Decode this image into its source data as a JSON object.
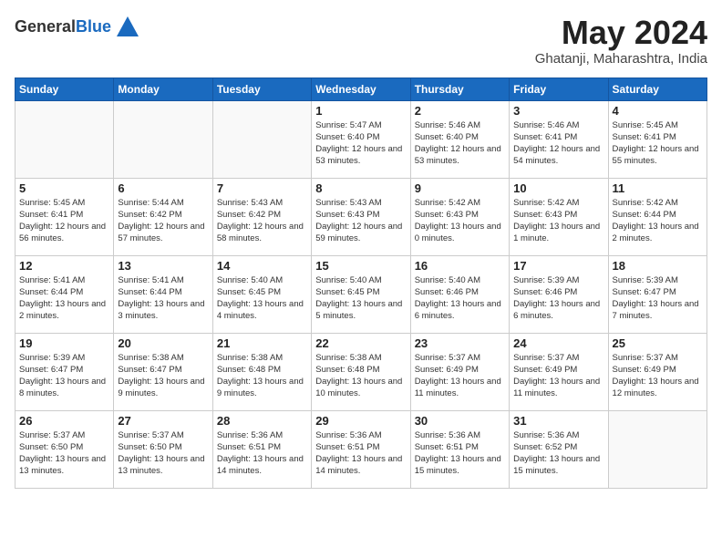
{
  "logo": {
    "general": "General",
    "blue": "Blue"
  },
  "title": "May 2024",
  "location": "Ghatanji, Maharashtra, India",
  "days_of_week": [
    "Sunday",
    "Monday",
    "Tuesday",
    "Wednesday",
    "Thursday",
    "Friday",
    "Saturday"
  ],
  "weeks": [
    [
      {
        "day": "",
        "info": ""
      },
      {
        "day": "",
        "info": ""
      },
      {
        "day": "",
        "info": ""
      },
      {
        "day": "1",
        "info": "Sunrise: 5:47 AM\nSunset: 6:40 PM\nDaylight: 12 hours\nand 53 minutes."
      },
      {
        "day": "2",
        "info": "Sunrise: 5:46 AM\nSunset: 6:40 PM\nDaylight: 12 hours\nand 53 minutes."
      },
      {
        "day": "3",
        "info": "Sunrise: 5:46 AM\nSunset: 6:41 PM\nDaylight: 12 hours\nand 54 minutes."
      },
      {
        "day": "4",
        "info": "Sunrise: 5:45 AM\nSunset: 6:41 PM\nDaylight: 12 hours\nand 55 minutes."
      }
    ],
    [
      {
        "day": "5",
        "info": "Sunrise: 5:45 AM\nSunset: 6:41 PM\nDaylight: 12 hours\nand 56 minutes."
      },
      {
        "day": "6",
        "info": "Sunrise: 5:44 AM\nSunset: 6:42 PM\nDaylight: 12 hours\nand 57 minutes."
      },
      {
        "day": "7",
        "info": "Sunrise: 5:43 AM\nSunset: 6:42 PM\nDaylight: 12 hours\nand 58 minutes."
      },
      {
        "day": "8",
        "info": "Sunrise: 5:43 AM\nSunset: 6:43 PM\nDaylight: 12 hours\nand 59 minutes."
      },
      {
        "day": "9",
        "info": "Sunrise: 5:42 AM\nSunset: 6:43 PM\nDaylight: 13 hours\nand 0 minutes."
      },
      {
        "day": "10",
        "info": "Sunrise: 5:42 AM\nSunset: 6:43 PM\nDaylight: 13 hours\nand 1 minute."
      },
      {
        "day": "11",
        "info": "Sunrise: 5:42 AM\nSunset: 6:44 PM\nDaylight: 13 hours\nand 2 minutes."
      }
    ],
    [
      {
        "day": "12",
        "info": "Sunrise: 5:41 AM\nSunset: 6:44 PM\nDaylight: 13 hours\nand 2 minutes."
      },
      {
        "day": "13",
        "info": "Sunrise: 5:41 AM\nSunset: 6:44 PM\nDaylight: 13 hours\nand 3 minutes."
      },
      {
        "day": "14",
        "info": "Sunrise: 5:40 AM\nSunset: 6:45 PM\nDaylight: 13 hours\nand 4 minutes."
      },
      {
        "day": "15",
        "info": "Sunrise: 5:40 AM\nSunset: 6:45 PM\nDaylight: 13 hours\nand 5 minutes."
      },
      {
        "day": "16",
        "info": "Sunrise: 5:40 AM\nSunset: 6:46 PM\nDaylight: 13 hours\nand 6 minutes."
      },
      {
        "day": "17",
        "info": "Sunrise: 5:39 AM\nSunset: 6:46 PM\nDaylight: 13 hours\nand 6 minutes."
      },
      {
        "day": "18",
        "info": "Sunrise: 5:39 AM\nSunset: 6:47 PM\nDaylight: 13 hours\nand 7 minutes."
      }
    ],
    [
      {
        "day": "19",
        "info": "Sunrise: 5:39 AM\nSunset: 6:47 PM\nDaylight: 13 hours\nand 8 minutes."
      },
      {
        "day": "20",
        "info": "Sunrise: 5:38 AM\nSunset: 6:47 PM\nDaylight: 13 hours\nand 9 minutes."
      },
      {
        "day": "21",
        "info": "Sunrise: 5:38 AM\nSunset: 6:48 PM\nDaylight: 13 hours\nand 9 minutes."
      },
      {
        "day": "22",
        "info": "Sunrise: 5:38 AM\nSunset: 6:48 PM\nDaylight: 13 hours\nand 10 minutes."
      },
      {
        "day": "23",
        "info": "Sunrise: 5:37 AM\nSunset: 6:49 PM\nDaylight: 13 hours\nand 11 minutes."
      },
      {
        "day": "24",
        "info": "Sunrise: 5:37 AM\nSunset: 6:49 PM\nDaylight: 13 hours\nand 11 minutes."
      },
      {
        "day": "25",
        "info": "Sunrise: 5:37 AM\nSunset: 6:49 PM\nDaylight: 13 hours\nand 12 minutes."
      }
    ],
    [
      {
        "day": "26",
        "info": "Sunrise: 5:37 AM\nSunset: 6:50 PM\nDaylight: 13 hours\nand 13 minutes."
      },
      {
        "day": "27",
        "info": "Sunrise: 5:37 AM\nSunset: 6:50 PM\nDaylight: 13 hours\nand 13 minutes."
      },
      {
        "day": "28",
        "info": "Sunrise: 5:36 AM\nSunset: 6:51 PM\nDaylight: 13 hours\nand 14 minutes."
      },
      {
        "day": "29",
        "info": "Sunrise: 5:36 AM\nSunset: 6:51 PM\nDaylight: 13 hours\nand 14 minutes."
      },
      {
        "day": "30",
        "info": "Sunrise: 5:36 AM\nSunset: 6:51 PM\nDaylight: 13 hours\nand 15 minutes."
      },
      {
        "day": "31",
        "info": "Sunrise: 5:36 AM\nSunset: 6:52 PM\nDaylight: 13 hours\nand 15 minutes."
      },
      {
        "day": "",
        "info": ""
      }
    ]
  ]
}
